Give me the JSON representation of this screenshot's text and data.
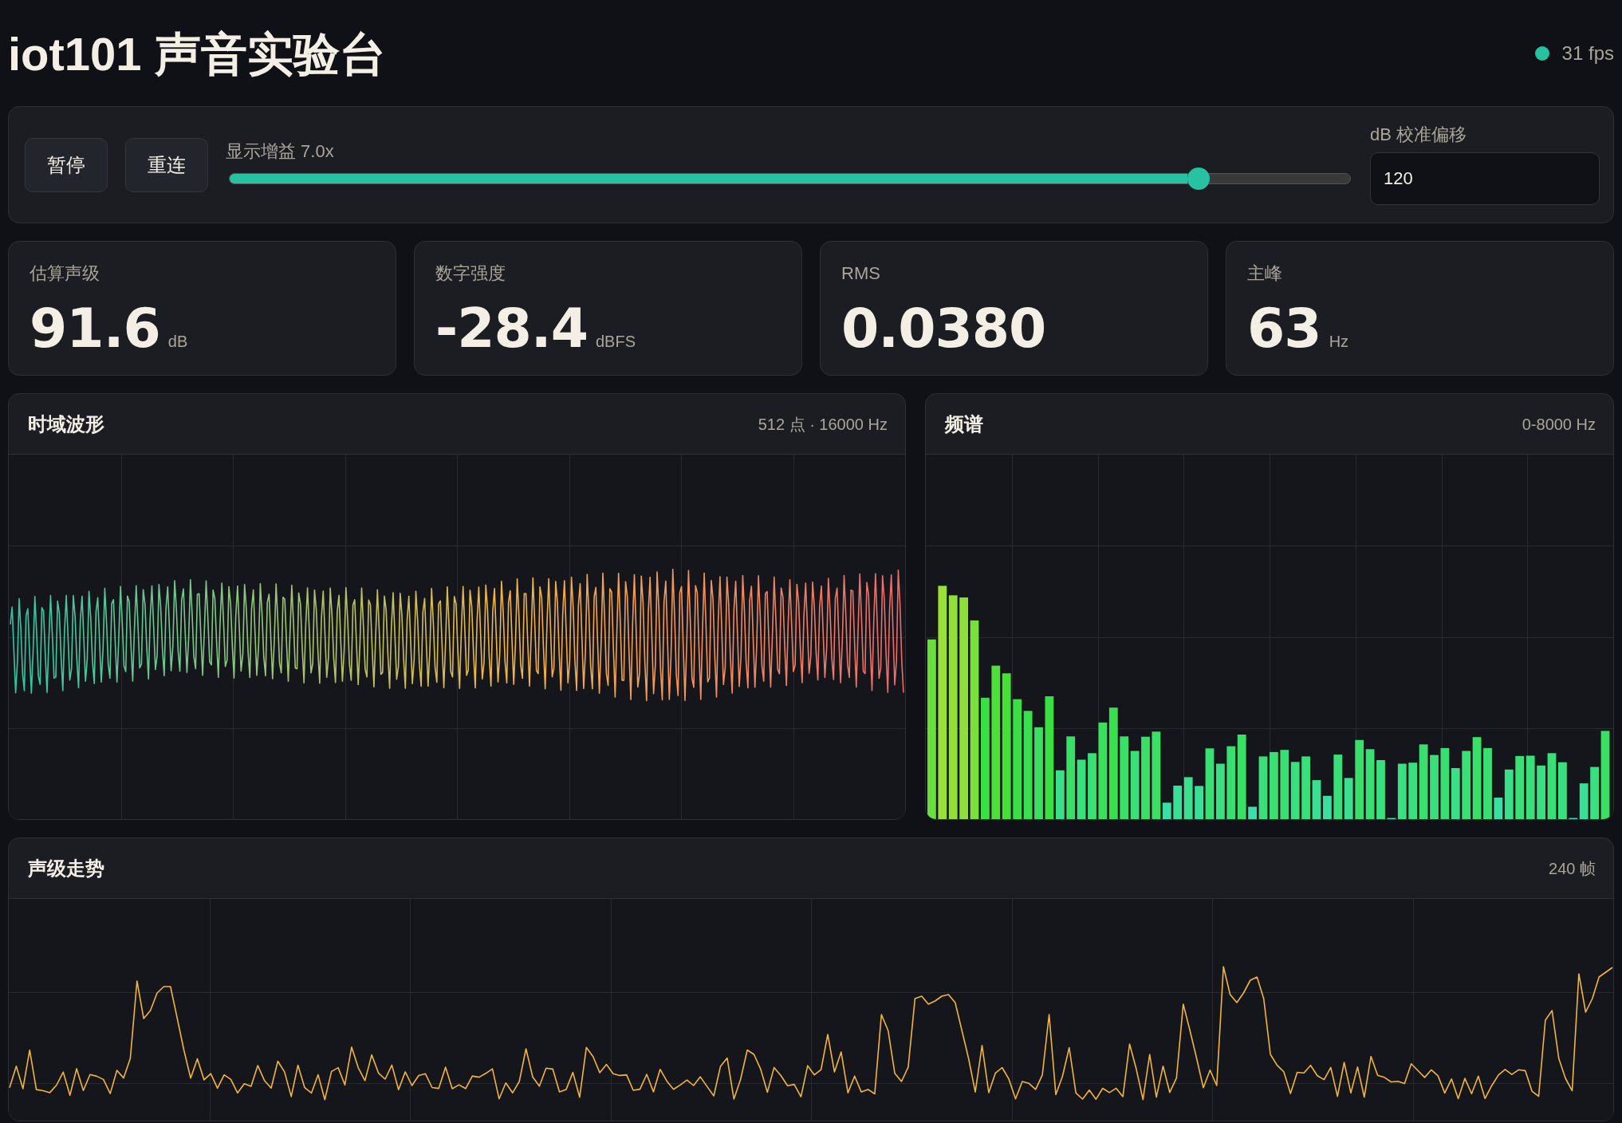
{
  "header": {
    "title": "iot101 声音实验台",
    "status": {
      "online": true,
      "text": "31 fps"
    }
  },
  "controls": {
    "buttons": [
      {
        "label": "暂停"
      },
      {
        "label": "重连"
      }
    ],
    "gain": {
      "label": "显示增益 7.0x",
      "level": 0.865
    },
    "offset": {
      "label": "dB 校准偏移",
      "value": "120"
    }
  },
  "stats": [
    {
      "label": "估算声级",
      "value": "91.6",
      "unit": "dB"
    },
    {
      "label": "数字强度",
      "value": "-28.4",
      "unit": "dBFS"
    },
    {
      "label": "RMS",
      "value": "0.0380"
    },
    {
      "label": "主峰",
      "value": "63",
      "unit": "Hz"
    }
  ],
  "panels": [
    {
      "kind": "waveform",
      "title": "时域波形",
      "meta": "512 点 · 16000 Hz"
    },
    {
      "kind": "spectrum",
      "title": "频谱",
      "meta": "0-8000 Hz"
    },
    {
      "kind": "trend",
      "title": "声级走势",
      "meta": "240 帧"
    }
  ]
}
